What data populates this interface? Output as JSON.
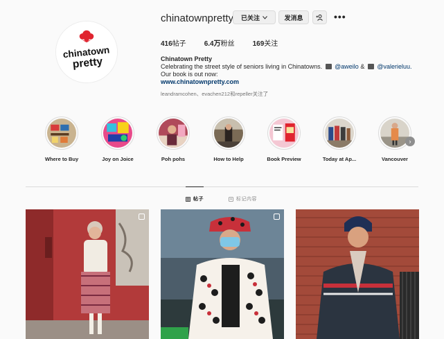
{
  "profile": {
    "username": "chinatownpretty",
    "following_button": "已关注",
    "message_button": "发消息",
    "avatar_text_line1": "chinatown",
    "avatar_text_line2": "pretty",
    "colors": {
      "brand_red": "#e0242f",
      "link": "#00376b"
    }
  },
  "stats": {
    "posts": "416",
    "posts_label": "帖子",
    "followers": "6.4万",
    "followers_label": "粉丝",
    "following": "169",
    "following_label": "关注"
  },
  "bio": {
    "name": "Chinatown Pretty",
    "line1_text": "Celebrating the street style of seniors living in Chinatowns.",
    "mention1": "@aweilo",
    "and": "&",
    "mention2": "@valerieluu.",
    "line2": "Our book is out now:",
    "link": "www.chinatownpretty.com",
    "followed_by": "leandramcohen、evachen212和repeller关注了"
  },
  "highlights": [
    {
      "label": "Where to Buy",
      "icon": "store-shelf-thumbnail"
    },
    {
      "label": "Joy on Joice",
      "icon": "colorful-graphic-thumbnail"
    },
    {
      "label": "Poh pohs",
      "icon": "portrait-thumbnail"
    },
    {
      "label": "How to Help",
      "icon": "street-thumbnail"
    },
    {
      "label": "Book Preview",
      "icon": "book-thumbnail"
    },
    {
      "label": "Today at Ap...",
      "icon": "gallery-thumbnail"
    },
    {
      "label": "Vancouver",
      "icon": "street-portrait-thumbnail"
    }
  ],
  "tabs": {
    "posts": "帖子",
    "tagged": "标记内容"
  },
  "icons": {
    "dropdown": "chevron-down-icon",
    "add_user": "add-user-icon",
    "more": "more-horizontal-icon",
    "next": "chevron-right-icon",
    "posts_tab": "grid-icon",
    "tagged_tab": "tag-icon",
    "multi": "multiple-images-icon"
  }
}
